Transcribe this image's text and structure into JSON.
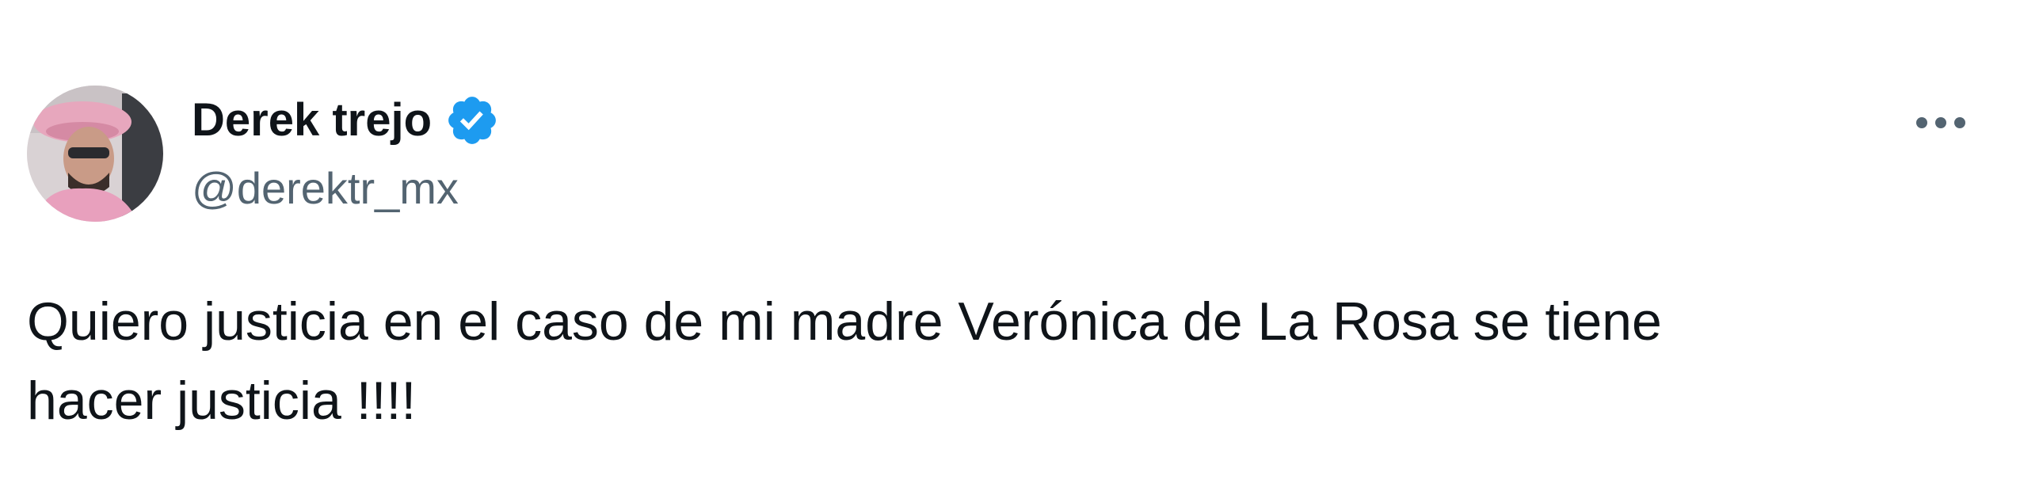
{
  "tweet": {
    "author": {
      "display_name": "Derek trejo",
      "handle": "@derektr_mx",
      "verified": true,
      "verified_icon": "verified-badge-icon",
      "verified_color": "#1d9bf0",
      "avatar": "avatar-photo"
    },
    "more_icon": "more-horizontal-icon",
    "text_line1": "Quiero justicia en el caso de mi madre Verónica de La Rosa se tiene",
    "text_line2": "hacer justicia !!!!"
  },
  "colors": {
    "text_primary": "#0f1419",
    "text_secondary": "#536471",
    "background": "#ffffff",
    "accent": "#1d9bf0"
  }
}
